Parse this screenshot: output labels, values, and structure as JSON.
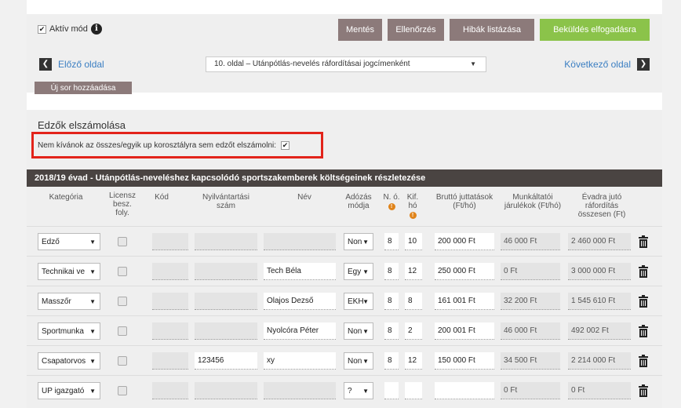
{
  "toolbar": {
    "aktiv_mod_label": "Aktív mód",
    "save_label": "Mentés",
    "check_label": "Ellenőrzés",
    "errors_label": "Hibák listázása",
    "submit_label": "Beküldés elfogadásra"
  },
  "nav": {
    "prev_label": "Előző oldal",
    "next_label": "Következő oldal",
    "page_select_value": "10. oldal – Utánpótlás-nevelés ráfordításai jogcímenként"
  },
  "new_row_label": "Új sor hozzáadása",
  "section": {
    "title": "Edzők elszámolása",
    "no_coach_label": "Nem kívánok az összes/egyik up korosztályra sem edzőt elszámolni:"
  },
  "table": {
    "title": "2018/19 évad - Utánpótlás-neveléshez kapcsolódó sportszakemberek költségeinek részletezése",
    "headers": {
      "kategoria": "Kategória",
      "licensz": "Licensz besz. foly.",
      "kod": "Kód",
      "nyilv": "Nyilvántartási szám",
      "nev": "Név",
      "adozas": "Adózás módja",
      "no": "N. ó.",
      "kifho": "Kif. hó",
      "brutto": "Bruttó juttatások (Ft/hó)",
      "munkaltatoi": "Munkáltatói járulékok (Ft/hó)",
      "evadra": "Évadra jutó ráfordítás összesen (Ft)"
    },
    "rows": [
      {
        "kategoria": "Edző",
        "nyilv": "",
        "nev": "",
        "adozas": "Non",
        "no": "8",
        "kifho": "10",
        "brutto": "200 000 Ft",
        "munkaltatoi": "46 000 Ft",
        "evadra": "2 460 000 Ft"
      },
      {
        "kategoria": "Technikai ve",
        "nyilv": "",
        "nev": "Tech Béla",
        "adozas": "Egy",
        "no": "8",
        "kifho": "12",
        "brutto": "250 000 Ft",
        "munkaltatoi": "0 Ft",
        "evadra": "3 000 000 Ft"
      },
      {
        "kategoria": "Masszőr",
        "nyilv": "",
        "nev": "Olajos Dezső",
        "adozas": "EKH",
        "no": "8",
        "kifho": "8",
        "brutto": "161 001 Ft",
        "munkaltatoi": "32 200 Ft",
        "evadra": "1 545 610 Ft"
      },
      {
        "kategoria": "Sportmunka",
        "nyilv": "",
        "nev": "Nyolcóra Péter",
        "adozas": "Non",
        "no": "8",
        "kifho": "2",
        "brutto": "200 001 Ft",
        "munkaltatoi": "46 000 Ft",
        "evadra": "492 002 Ft"
      },
      {
        "kategoria": "Csapatorvos",
        "nyilv": "123456",
        "nev": "xy",
        "adozas": "Non",
        "no": "8",
        "kifho": "12",
        "brutto": "150 000 Ft",
        "munkaltatoi": "34 500 Ft",
        "evadra": "2 214 000 Ft"
      },
      {
        "kategoria": "UP igazgató",
        "nyilv": "",
        "nev": "",
        "adozas": "?",
        "no": "",
        "kifho": "",
        "brutto": "",
        "munkaltatoi": "0 Ft",
        "evadra": "0 Ft"
      }
    ]
  },
  "colors": {
    "gray_button": "#8c7a7a",
    "green_button": "#8bc34a",
    "link": "#3a7ec2",
    "table_header": "#4a4442",
    "highlight_box": "#e2231a",
    "warn": "#e0841b"
  }
}
